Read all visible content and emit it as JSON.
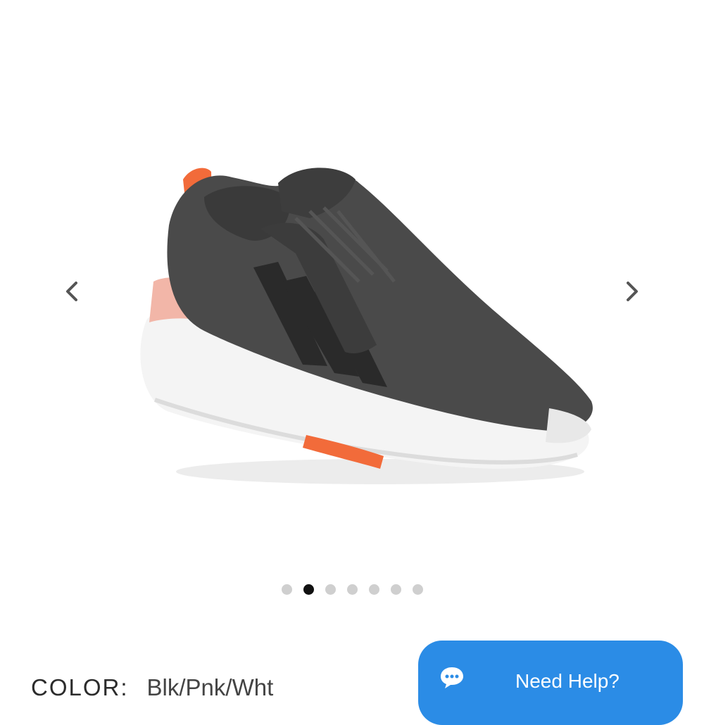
{
  "gallery": {
    "image_alt": "adidas sneaker, gray mesh with pink and orange accents",
    "total_images": 7,
    "active_index": 1,
    "prev_icon": "chevron-left-icon",
    "next_icon": "chevron-right-icon"
  },
  "product": {
    "color_label": "COLOR:",
    "color_value": "Blk/Pnk/Wht"
  },
  "help": {
    "label": "Need Help?",
    "icon": "chat-bubble-icon",
    "color": "#2b8ce6"
  },
  "colors": {
    "shoe_body": "#4a4a4a",
    "accent_orange": "#f26b3a",
    "accent_pink": "#f2b6a8"
  }
}
